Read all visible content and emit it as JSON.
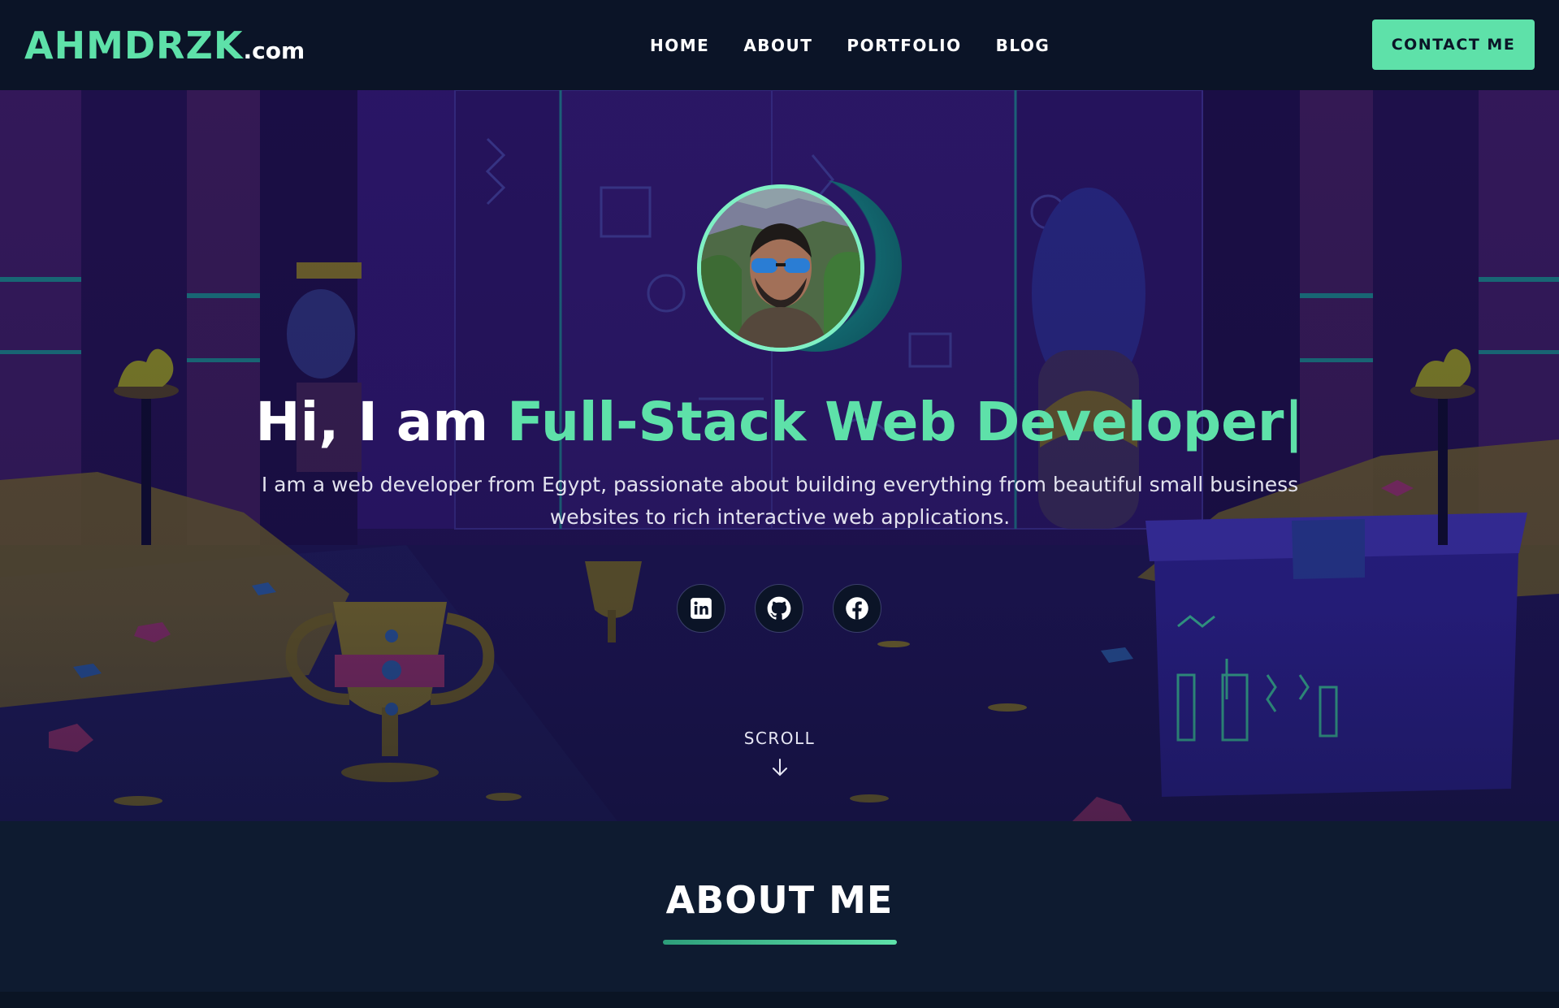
{
  "nav": {
    "logo_main": "AHMDRZK",
    "logo_tld": ".com",
    "links": [
      "HOME",
      "ABOUT",
      "PORTFOLIO",
      "BLOG"
    ],
    "contact_label": "CONTACT ME"
  },
  "hero": {
    "title_prefix": "Hi, I am ",
    "title_accent": "Full-Stack Web Developer|",
    "description": "I am a web developer from Egypt, passionate about building everything from beautiful small business websites to rich interactive web applications.",
    "socials": [
      {
        "icon": "linkedin-icon"
      },
      {
        "icon": "github-icon"
      },
      {
        "icon": "facebook-icon"
      }
    ],
    "scroll_label": "SCROLL"
  },
  "about": {
    "title": "ABOUT ME"
  },
  "colors": {
    "accent": "#5ee1a9",
    "navbar": "#0b1427",
    "hero_bg": "#24125a",
    "about_bg": "#0e1b30"
  }
}
